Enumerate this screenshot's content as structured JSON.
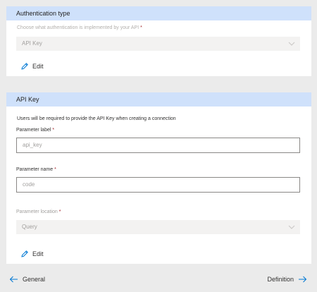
{
  "auth": {
    "header": "Authentication type",
    "hint": "Choose what authentication is implemented by your API",
    "required_mark": "*",
    "selected": "API Key",
    "edit_label": "Edit"
  },
  "apikey": {
    "header": "API Key",
    "description": "Users will be required to provide the API Key when creating a connection",
    "param_label": {
      "label": "Parameter label",
      "required_mark": "*",
      "placeholder": "api_key"
    },
    "param_name": {
      "label": "Parameter name",
      "required_mark": "*",
      "placeholder": "code"
    },
    "param_location": {
      "label": "Parameter location",
      "required_mark": "*",
      "selected": "Query"
    },
    "edit_label": "Edit"
  },
  "footer": {
    "back_label": "General",
    "next_label": "Definition"
  },
  "colors": {
    "header_bg": "#cfe1fb",
    "accent": "#0078d4",
    "required": "#a4262c"
  },
  "icons": [
    "pencil-icon",
    "chevron-down-icon",
    "arrow-left-icon",
    "arrow-right-icon"
  ]
}
